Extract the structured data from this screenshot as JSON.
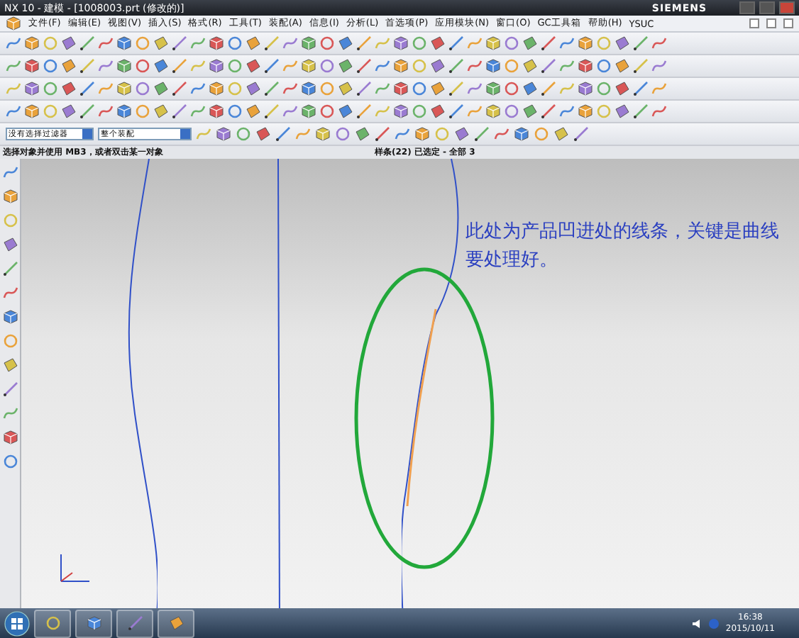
{
  "window": {
    "title": "NX 10 - 建模 - [1008003.prt (修改的)]",
    "brand": "SIEMENS"
  },
  "menu": [
    "文件(F)",
    "编辑(E)",
    "视图(V)",
    "插入(S)",
    "格式(R)",
    "工具(T)",
    "装配(A)",
    "信息(I)",
    "分析(L)",
    "首选项(P)",
    "应用模块(N)",
    "窗口(O)",
    "GC工具箱",
    "帮助(H)",
    "YSUC"
  ],
  "selection_bar": {
    "filter": "没有选择过滤器",
    "scope": "整个装配"
  },
  "status_bar": {
    "prompt": "选择对象并使用 MB3，或者双击某一对象",
    "selection": "样条(22) 已选定 - 全部 3"
  },
  "canvas": {
    "annotation": "此处为产品凹进处的线条，关键是曲线要处理好。"
  },
  "taskbar": {
    "time": "16:38",
    "date": "2015/10/11"
  }
}
